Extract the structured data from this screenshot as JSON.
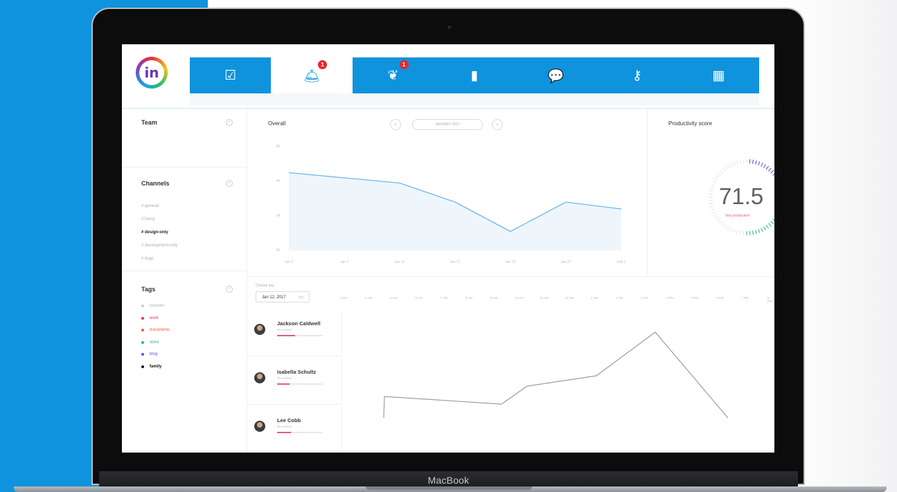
{
  "device": {
    "label": "MacBook"
  },
  "app": {
    "logo_text": "in",
    "nav": [
      {
        "icon": "calendar-check-icon",
        "glyph": "☑",
        "badge": ""
      },
      {
        "icon": "room-service-bell-icon",
        "glyph": "🛎",
        "badge": "1",
        "active": true
      },
      {
        "icon": "leaves-icon",
        "glyph": "❦",
        "badge": "1"
      },
      {
        "icon": "door-hanger-icon",
        "glyph": "▮",
        "badge": ""
      },
      {
        "icon": "chat-bubbles-icon",
        "glyph": "💬",
        "badge": ""
      },
      {
        "icon": "key-icon",
        "glyph": "⚷",
        "badge": ""
      },
      {
        "icon": "apps-grid-icon",
        "glyph": "▦",
        "badge": ""
      }
    ]
  },
  "sidebar": {
    "team": {
      "title": "Team"
    },
    "channels": {
      "title": "Channels",
      "items": [
        "# general",
        "# funny",
        "# design-only",
        "# development-only",
        "# bugs"
      ],
      "active_index": 2
    },
    "tags": {
      "title": "Tags",
      "items": [
        {
          "label": "courses",
          "color": "#c9ccd2"
        },
        {
          "label": "work",
          "color": "#e8306f"
        },
        {
          "label": "documents",
          "color": "#f05a3c"
        },
        {
          "label": "store",
          "color": "#2bbd6b"
        },
        {
          "label": "blog",
          "color": "#5a56d8"
        },
        {
          "label": "family",
          "color": "#111111"
        }
      ]
    }
  },
  "overall": {
    "title": "Overall",
    "date": "JANUARY 2017",
    "prev": "‹",
    "next": "›"
  },
  "productivity": {
    "title": "Productivity score",
    "value": "71.5",
    "label": "Very productive!"
  },
  "timeline": {
    "choose_day_label": "Choose day",
    "date": "Jan 12, 2017",
    "calendar_icon": "▭",
    "hours": [
      "3 AM",
      "4 AM",
      "5 AM",
      "6 AM",
      "7 AM",
      "8 AM",
      "9 AM",
      "10 AM",
      "11 AM",
      "12 PM",
      "1 PM",
      "2 PM",
      "3 PM",
      "4 PM",
      "5 PM",
      "6 PM",
      "7 PM",
      "8 PM"
    ],
    "people": [
      {
        "name": "Jackson Caldwell",
        "tracked": "5h tracked",
        "progress": 0.4
      },
      {
        "name": "Isabella Schultz",
        "tracked": "7h tracked",
        "progress": 0.28
      },
      {
        "name": "Lee Cobb",
        "tracked": "8h tracked",
        "progress": 0.3
      }
    ]
  },
  "chart_data": [
    {
      "type": "line",
      "title": "Overall",
      "x": [
        "Jan 2",
        "Jan 7",
        "Jan 12",
        "Jan 17",
        "Jan 22",
        "Jan 27",
        "Feb 1"
      ],
      "y_ticks": [
        "6h",
        "4h",
        "2h",
        "0h"
      ],
      "ylim": [
        0,
        6
      ],
      "series": [
        {
          "values": [
            4.5,
            4.2,
            3.9,
            2.8,
            1.1,
            2.8,
            2.4
          ],
          "color": "#6bb8e6"
        }
      ]
    },
    {
      "type": "line",
      "title": "",
      "series": [
        {
          "values": [
            3.0,
            2.95,
            2.9,
            3.4,
            3.6,
            5.2,
            1.0
          ],
          "color": "#9a9da4"
        }
      ]
    }
  ]
}
